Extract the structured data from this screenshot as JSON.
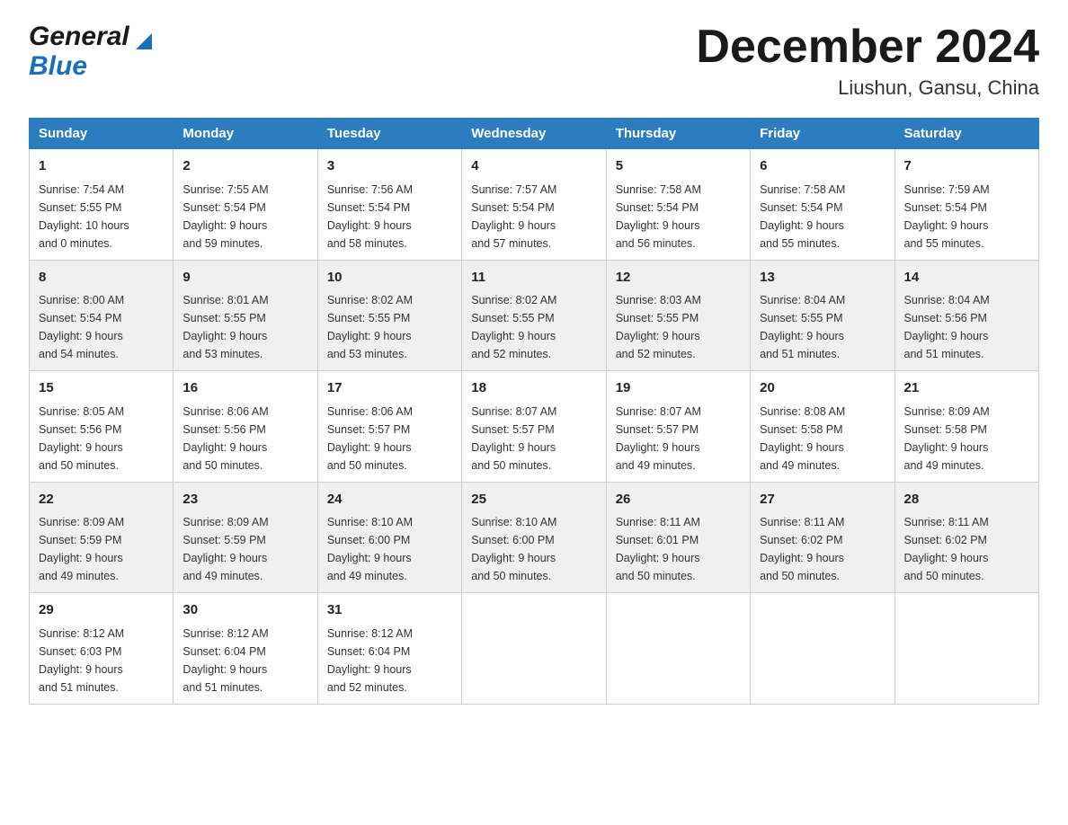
{
  "logo": {
    "general": "General",
    "blue": "Blue"
  },
  "title": "December 2024",
  "subtitle": "Liushun, Gansu, China",
  "days_of_week": [
    "Sunday",
    "Monday",
    "Tuesday",
    "Wednesday",
    "Thursday",
    "Friday",
    "Saturday"
  ],
  "weeks": [
    [
      {
        "day": "1",
        "sunrise": "7:54 AM",
        "sunset": "5:55 PM",
        "daylight": "10 hours and 0 minutes."
      },
      {
        "day": "2",
        "sunrise": "7:55 AM",
        "sunset": "5:54 PM",
        "daylight": "9 hours and 59 minutes."
      },
      {
        "day": "3",
        "sunrise": "7:56 AM",
        "sunset": "5:54 PM",
        "daylight": "9 hours and 58 minutes."
      },
      {
        "day": "4",
        "sunrise": "7:57 AM",
        "sunset": "5:54 PM",
        "daylight": "9 hours and 57 minutes."
      },
      {
        "day": "5",
        "sunrise": "7:58 AM",
        "sunset": "5:54 PM",
        "daylight": "9 hours and 56 minutes."
      },
      {
        "day": "6",
        "sunrise": "7:58 AM",
        "sunset": "5:54 PM",
        "daylight": "9 hours and 55 minutes."
      },
      {
        "day": "7",
        "sunrise": "7:59 AM",
        "sunset": "5:54 PM",
        "daylight": "9 hours and 55 minutes."
      }
    ],
    [
      {
        "day": "8",
        "sunrise": "8:00 AM",
        "sunset": "5:54 PM",
        "daylight": "9 hours and 54 minutes."
      },
      {
        "day": "9",
        "sunrise": "8:01 AM",
        "sunset": "5:55 PM",
        "daylight": "9 hours and 53 minutes."
      },
      {
        "day": "10",
        "sunrise": "8:02 AM",
        "sunset": "5:55 PM",
        "daylight": "9 hours and 53 minutes."
      },
      {
        "day": "11",
        "sunrise": "8:02 AM",
        "sunset": "5:55 PM",
        "daylight": "9 hours and 52 minutes."
      },
      {
        "day": "12",
        "sunrise": "8:03 AM",
        "sunset": "5:55 PM",
        "daylight": "9 hours and 52 minutes."
      },
      {
        "day": "13",
        "sunrise": "8:04 AM",
        "sunset": "5:55 PM",
        "daylight": "9 hours and 51 minutes."
      },
      {
        "day": "14",
        "sunrise": "8:04 AM",
        "sunset": "5:56 PM",
        "daylight": "9 hours and 51 minutes."
      }
    ],
    [
      {
        "day": "15",
        "sunrise": "8:05 AM",
        "sunset": "5:56 PM",
        "daylight": "9 hours and 50 minutes."
      },
      {
        "day": "16",
        "sunrise": "8:06 AM",
        "sunset": "5:56 PM",
        "daylight": "9 hours and 50 minutes."
      },
      {
        "day": "17",
        "sunrise": "8:06 AM",
        "sunset": "5:57 PM",
        "daylight": "9 hours and 50 minutes."
      },
      {
        "day": "18",
        "sunrise": "8:07 AM",
        "sunset": "5:57 PM",
        "daylight": "9 hours and 50 minutes."
      },
      {
        "day": "19",
        "sunrise": "8:07 AM",
        "sunset": "5:57 PM",
        "daylight": "9 hours and 49 minutes."
      },
      {
        "day": "20",
        "sunrise": "8:08 AM",
        "sunset": "5:58 PM",
        "daylight": "9 hours and 49 minutes."
      },
      {
        "day": "21",
        "sunrise": "8:09 AM",
        "sunset": "5:58 PM",
        "daylight": "9 hours and 49 minutes."
      }
    ],
    [
      {
        "day": "22",
        "sunrise": "8:09 AM",
        "sunset": "5:59 PM",
        "daylight": "9 hours and 49 minutes."
      },
      {
        "day": "23",
        "sunrise": "8:09 AM",
        "sunset": "5:59 PM",
        "daylight": "9 hours and 49 minutes."
      },
      {
        "day": "24",
        "sunrise": "8:10 AM",
        "sunset": "6:00 PM",
        "daylight": "9 hours and 49 minutes."
      },
      {
        "day": "25",
        "sunrise": "8:10 AM",
        "sunset": "6:00 PM",
        "daylight": "9 hours and 50 minutes."
      },
      {
        "day": "26",
        "sunrise": "8:11 AM",
        "sunset": "6:01 PM",
        "daylight": "9 hours and 50 minutes."
      },
      {
        "day": "27",
        "sunrise": "8:11 AM",
        "sunset": "6:02 PM",
        "daylight": "9 hours and 50 minutes."
      },
      {
        "day": "28",
        "sunrise": "8:11 AM",
        "sunset": "6:02 PM",
        "daylight": "9 hours and 50 minutes."
      }
    ],
    [
      {
        "day": "29",
        "sunrise": "8:12 AM",
        "sunset": "6:03 PM",
        "daylight": "9 hours and 51 minutes."
      },
      {
        "day": "30",
        "sunrise": "8:12 AM",
        "sunset": "6:04 PM",
        "daylight": "9 hours and 51 minutes."
      },
      {
        "day": "31",
        "sunrise": "8:12 AM",
        "sunset": "6:04 PM",
        "daylight": "9 hours and 52 minutes."
      },
      null,
      null,
      null,
      null
    ]
  ],
  "labels": {
    "sunrise": "Sunrise:",
    "sunset": "Sunset:",
    "daylight": "Daylight:"
  }
}
